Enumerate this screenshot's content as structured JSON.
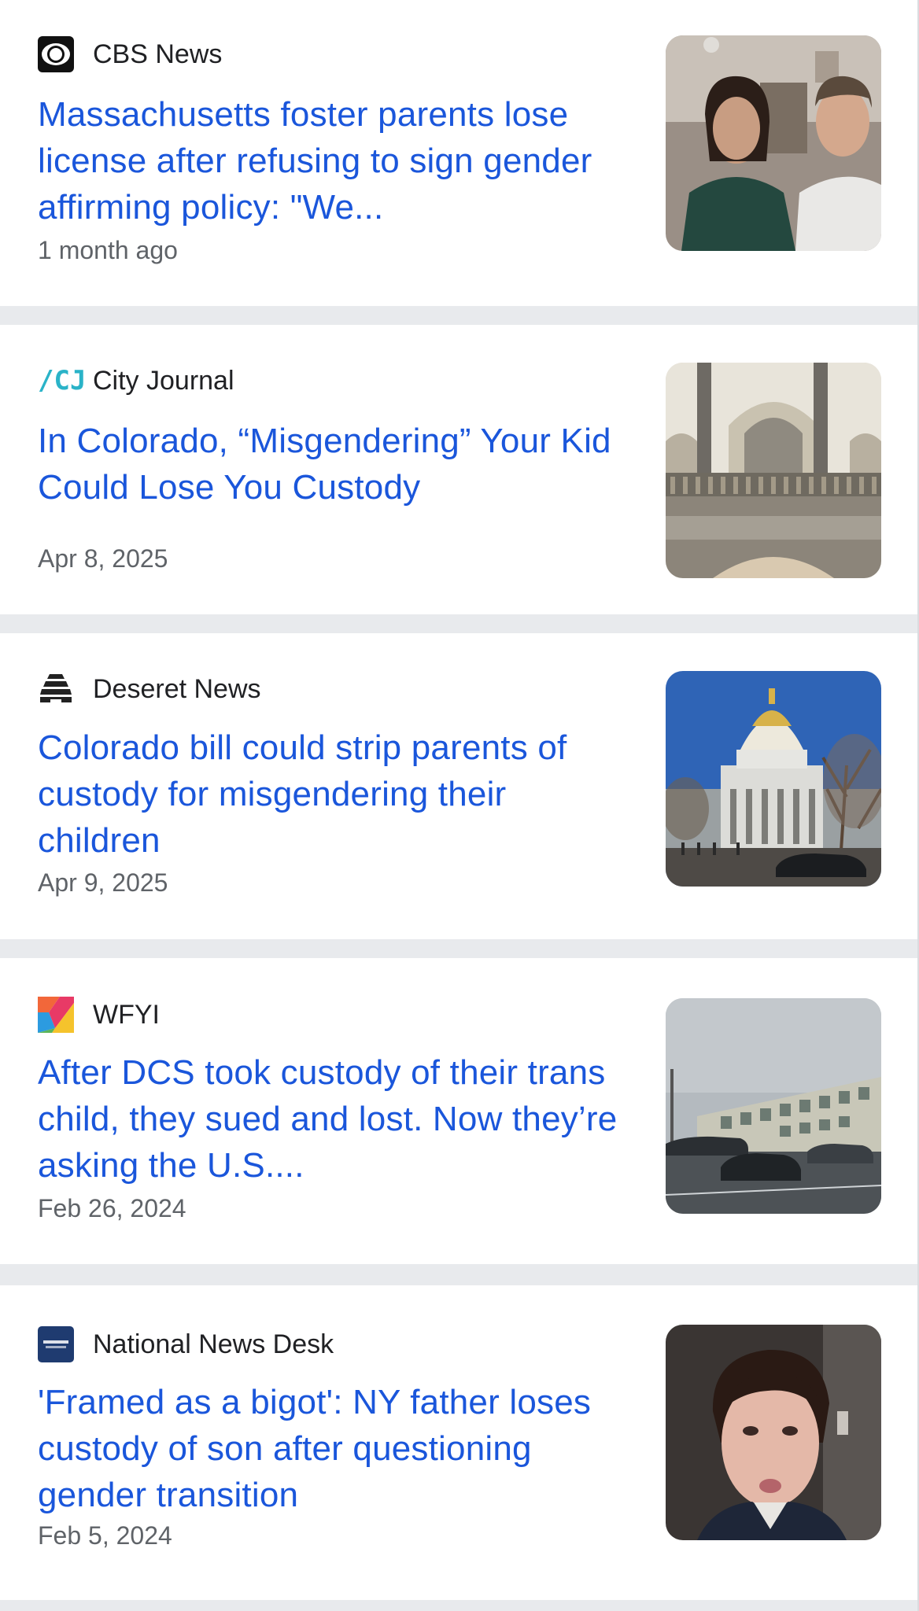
{
  "articles": [
    {
      "source": "CBS News",
      "logo_icon": "cbs-eye-icon",
      "headline": "Massachusetts foster parents lose license after refusing to sign gender affirming policy: \"We...",
      "date": "1 month ago",
      "thumbnail": "two-people-interview-photo"
    },
    {
      "source": "City Journal",
      "logo_icon": "city-journal-cj-icon",
      "logo_text": "/CJ",
      "headline": "In Colorado, “Misgendering” Your Kid Could Lose You Custody",
      "date": "Apr 8, 2025",
      "thumbnail": "capitol-interior-arches-photo"
    },
    {
      "source": "Deseret News",
      "logo_icon": "deseret-beehive-icon",
      "headline": "Colorado bill could strip parents of custody for misgendering their children",
      "date": "Apr 9, 2025",
      "thumbnail": "colorado-capitol-dome-photo"
    },
    {
      "source": "WFYI",
      "logo_icon": "wfyi-color-blocks-icon",
      "headline": "After DCS took custody of their trans child, they sued and lost. Now they’re asking the U.S....",
      "date": "Feb 26, 2024",
      "thumbnail": "parking-lot-building-photo"
    },
    {
      "source": "National News Desk",
      "logo_icon": "national-news-desk-icon",
      "headline": "'Framed as a bigot': NY father loses custody of son after questioning gender transition",
      "date": "Feb 5, 2024",
      "thumbnail": "man-video-call-photo"
    }
  ],
  "colors": {
    "headline": "#1a56db",
    "source_text": "#202124",
    "date_text": "#5f6368",
    "separator": "#e8eaed"
  }
}
